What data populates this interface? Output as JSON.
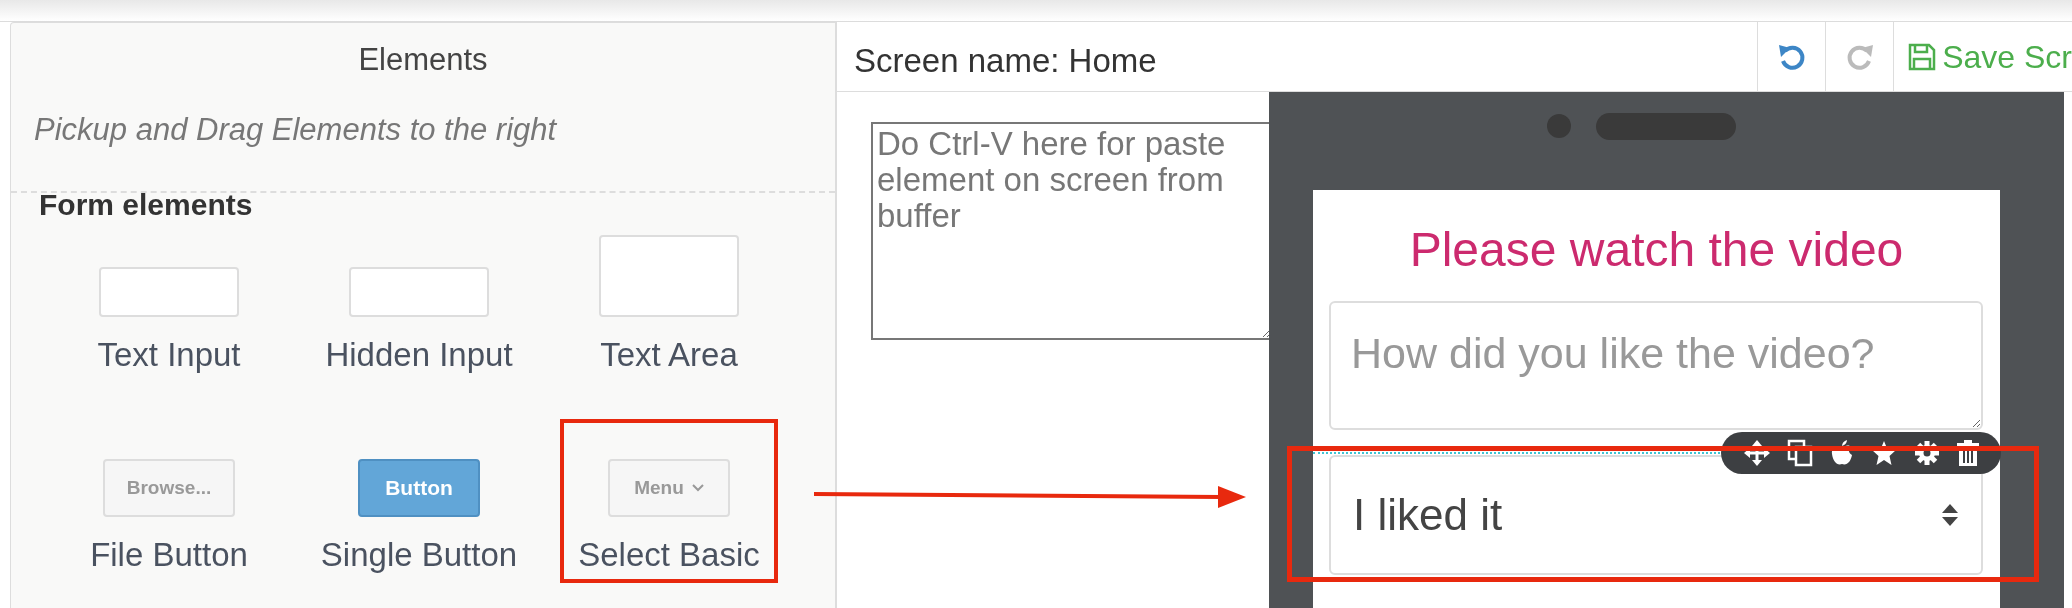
{
  "elements_panel": {
    "title": "Elements",
    "hint": "Pickup and Drag Elements to the right",
    "section": "Form elements",
    "items": [
      {
        "kind": "text-input",
        "label": "Text Input",
        "highlighted": false
      },
      {
        "kind": "text-input",
        "label": "Hidden Input",
        "highlighted": false
      },
      {
        "kind": "text-area",
        "label": "Text Area",
        "highlighted": false
      },
      {
        "kind": "file-button",
        "preview": "Browse...",
        "label": "File Button",
        "highlighted": false
      },
      {
        "kind": "single-button",
        "preview": "Button",
        "label": "Single Button",
        "highlighted": false
      },
      {
        "kind": "select",
        "preview": "Menu",
        "label": "Select Basic",
        "highlighted": true
      }
    ]
  },
  "editor": {
    "screen_name": "Screen name: Home",
    "toolbar": [
      {
        "kind": "undo",
        "disabled": false
      },
      {
        "kind": "redo",
        "disabled": true
      },
      {
        "kind": "save",
        "label": "Save Scr",
        "disabled": false
      }
    ]
  },
  "paste_area": {
    "placeholder": "Do Ctrl-V here for paste element on screen from buffer"
  },
  "phone": {
    "title": "Please watch the video",
    "textarea": {
      "placeholder": "How did you like the video?"
    },
    "select": {
      "value": "I liked it",
      "highlighted": true
    }
  }
}
